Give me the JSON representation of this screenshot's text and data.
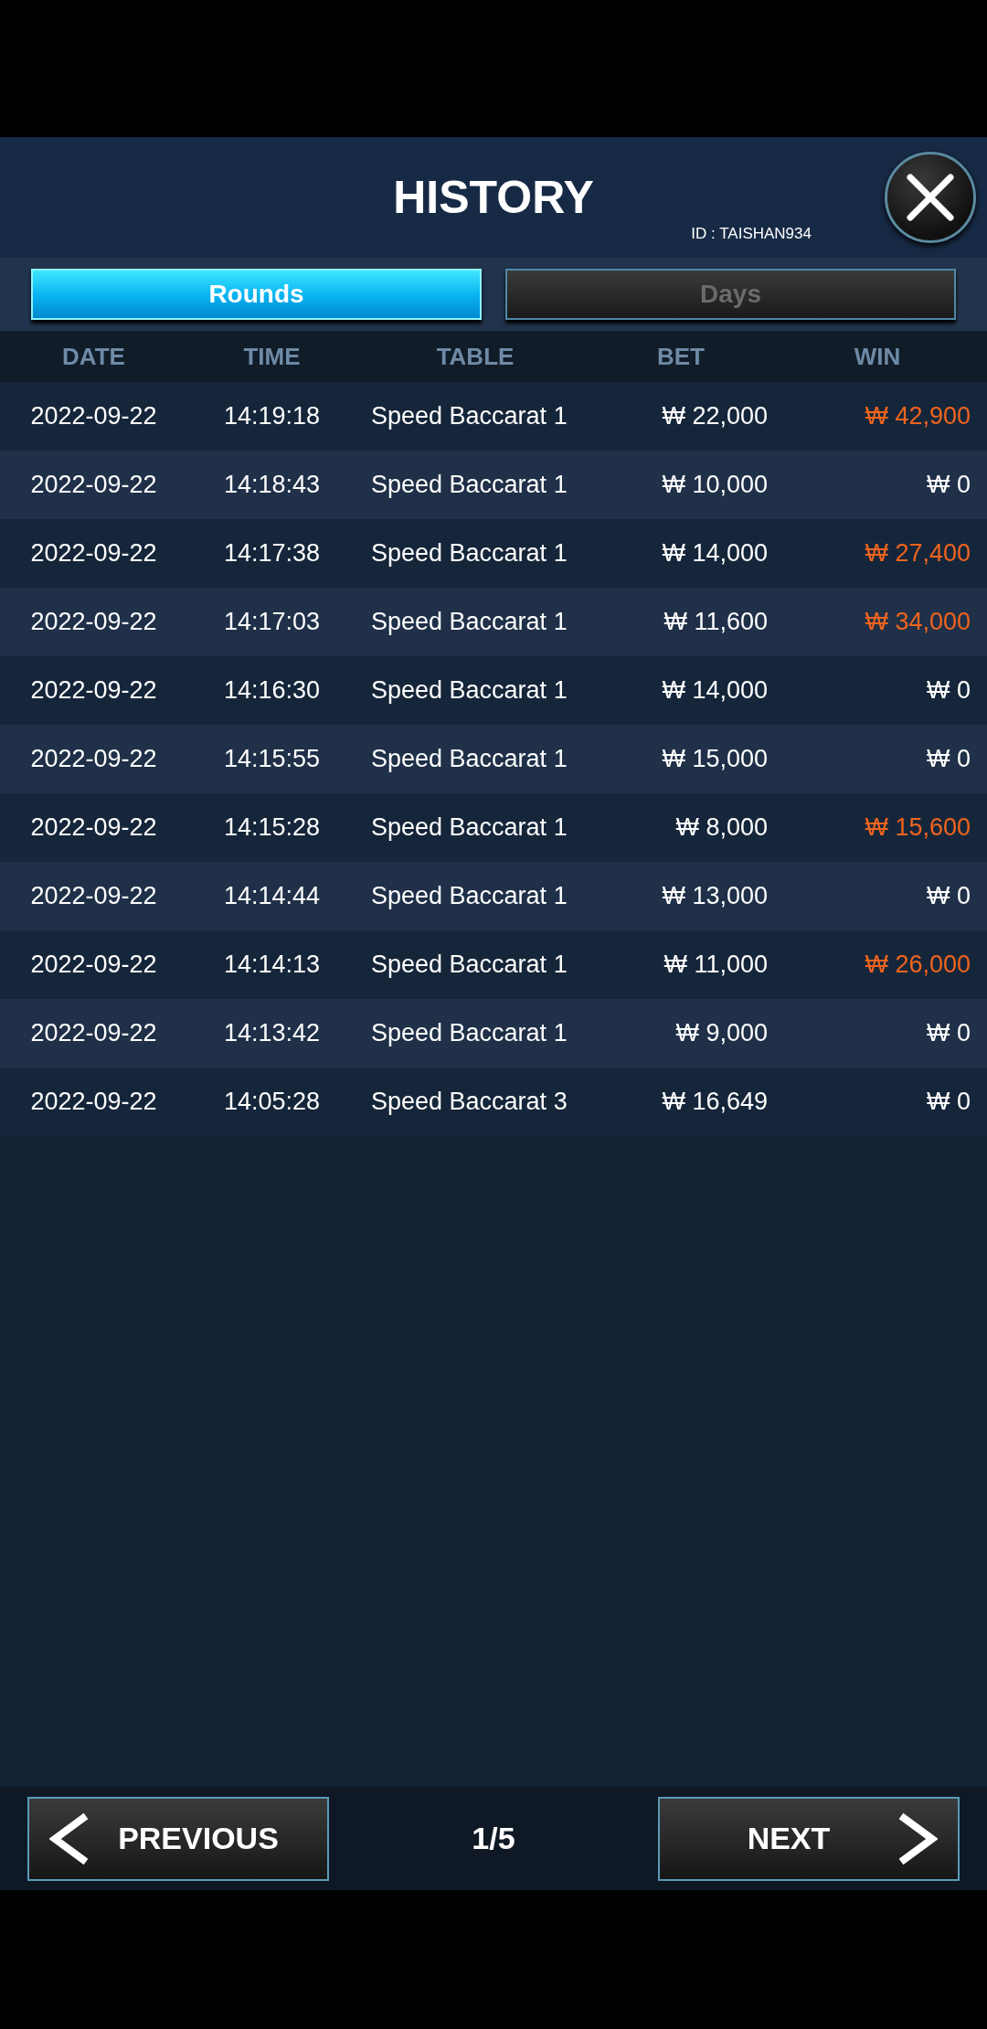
{
  "header": {
    "title": "HISTORY",
    "user_id": "ID : TAISHAN934"
  },
  "tabs": [
    {
      "label": "Rounds",
      "selected": true
    },
    {
      "label": "Days",
      "selected": false
    }
  ],
  "table": {
    "columns": [
      "DATE",
      "TIME",
      "TABLE",
      "BET",
      "WIN"
    ],
    "rows": [
      {
        "date": "2022-09-22",
        "time": "14:19:18",
        "table": "Speed Baccarat 1",
        "bet": "₩ 22,000",
        "win": "₩ 42,900",
        "won": true
      },
      {
        "date": "2022-09-22",
        "time": "14:18:43",
        "table": "Speed Baccarat 1",
        "bet": "₩ 10,000",
        "win": "₩ 0",
        "won": false
      },
      {
        "date": "2022-09-22",
        "time": "14:17:38",
        "table": "Speed Baccarat 1",
        "bet": "₩ 14,000",
        "win": "₩ 27,400",
        "won": true
      },
      {
        "date": "2022-09-22",
        "time": "14:17:03",
        "table": "Speed Baccarat 1",
        "bet": "₩ 11,600",
        "win": "₩ 34,000",
        "won": true
      },
      {
        "date": "2022-09-22",
        "time": "14:16:30",
        "table": "Speed Baccarat 1",
        "bet": "₩ 14,000",
        "win": "₩ 0",
        "won": false
      },
      {
        "date": "2022-09-22",
        "time": "14:15:55",
        "table": "Speed Baccarat 1",
        "bet": "₩ 15,000",
        "win": "₩ 0",
        "won": false
      },
      {
        "date": "2022-09-22",
        "time": "14:15:28",
        "table": "Speed Baccarat 1",
        "bet": "₩ 8,000",
        "win": "₩ 15,600",
        "won": true
      },
      {
        "date": "2022-09-22",
        "time": "14:14:44",
        "table": "Speed Baccarat 1",
        "bet": "₩ 13,000",
        "win": "₩ 0",
        "won": false
      },
      {
        "date": "2022-09-22",
        "time": "14:14:13",
        "table": "Speed Baccarat 1",
        "bet": "₩ 11,000",
        "win": "₩ 26,000",
        "won": true
      },
      {
        "date": "2022-09-22",
        "time": "14:13:42",
        "table": "Speed Baccarat 1",
        "bet": "₩ 9,000",
        "win": "₩ 0",
        "won": false
      },
      {
        "date": "2022-09-22",
        "time": "14:05:28",
        "table": "Speed Baccarat 3",
        "bet": "₩ 16,649",
        "win": "₩ 0",
        "won": false
      }
    ]
  },
  "pagination": {
    "previous": "PREVIOUS",
    "page": "1/5",
    "next": "NEXT"
  }
}
